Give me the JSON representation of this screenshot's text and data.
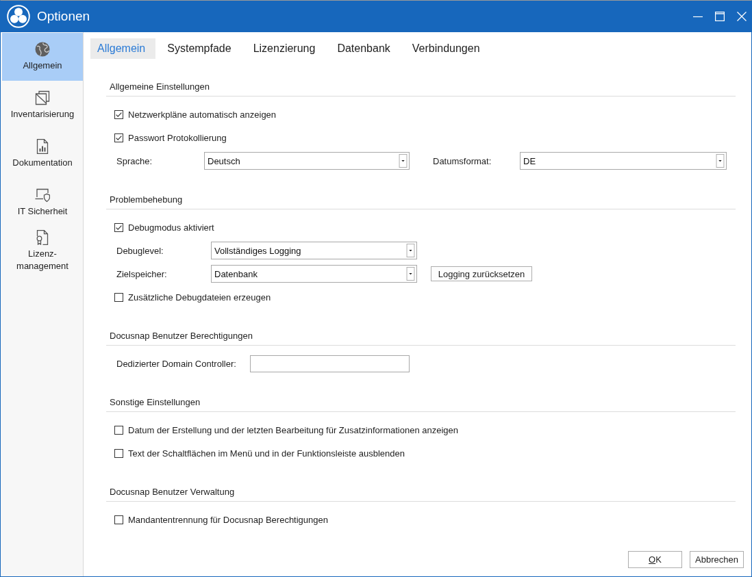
{
  "window": {
    "title": "Optionen"
  },
  "sidebar": {
    "items": [
      {
        "label": "Allgemein",
        "selected": true
      },
      {
        "label": "Inventarisierung",
        "selected": false
      },
      {
        "label": "Dokumentation",
        "selected": false
      },
      {
        "label": "IT Sicherheit",
        "selected": false
      },
      {
        "label": "Lizenz-\nmanagement",
        "selected": false
      }
    ]
  },
  "tabs": [
    {
      "label": "Allgemein",
      "selected": true
    },
    {
      "label": "Systempfade",
      "selected": false
    },
    {
      "label": "Lizenzierung",
      "selected": false
    },
    {
      "label": "Datenbank",
      "selected": false
    },
    {
      "label": "Verbindungen",
      "selected": false
    }
  ],
  "sections": [
    {
      "title": "Allgemeine Einstellungen",
      "rows": [
        {
          "kind": "checkbox",
          "label": "Netzwerkpläne automatisch anzeigen",
          "checked": true
        },
        {
          "kind": "checkbox",
          "label": "Passwort Protokollierung",
          "checked": true
        },
        {
          "kind": "dropdown_pair",
          "fields": [
            {
              "label": "Sprache:",
              "value": "Deutsch"
            },
            {
              "label": "Datumsformat:",
              "value": "DE"
            }
          ]
        }
      ]
    },
    {
      "title": "Problembehebung",
      "rows": [
        {
          "kind": "checkbox",
          "label": "Debugmodus aktiviert",
          "checked": true
        },
        {
          "kind": "dropdown",
          "label": "Debuglevel:",
          "value": "Vollständiges Logging"
        },
        {
          "kind": "dropdown",
          "label": "Zielspeicher:",
          "value": "Datenbank",
          "button": "Logging zurücksetzen"
        },
        {
          "kind": "checkbox",
          "label": "Zusätzliche Debugdateien erzeugen",
          "checked": false
        }
      ]
    },
    {
      "title": "Docusnap Benutzer Berechtigungen",
      "rows": [
        {
          "kind": "text_field",
          "label": "Dedizierter Domain Controller:"
        }
      ]
    },
    {
      "title": "Sonstige Einstellungen",
      "rows": [
        {
          "kind": "checkbox",
          "label": "Datum der Erstellung und der letzten Bearbeitung für Zusatzinformationen anzeigen",
          "checked": false
        },
        {
          "kind": "checkbox",
          "label": "Text der Schaltflächen im Menü und in der Funktionsleiste ausblenden",
          "checked": false
        }
      ]
    },
    {
      "title": "Docusnap Benutzer Verwaltung",
      "rows": [
        {
          "kind": "checkbox",
          "label": "Mandantentrennung für Docusnap Berechtigungen",
          "checked": false
        }
      ]
    }
  ],
  "buttons": [
    {
      "label": "OK",
      "access_key_shown": true
    },
    {
      "label": "Abbrechen",
      "access_key_shown": false
    }
  ]
}
